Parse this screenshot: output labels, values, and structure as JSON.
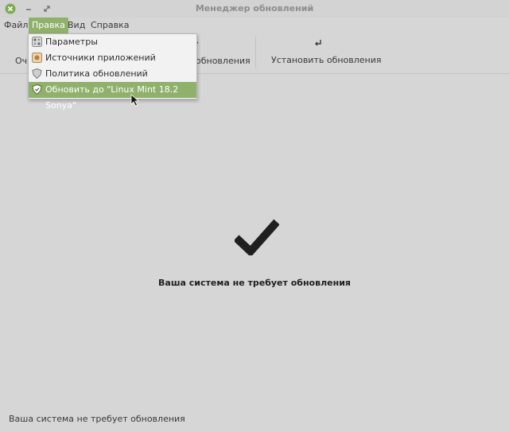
{
  "window": {
    "title": "Менеджер обновлений"
  },
  "menubar": {
    "items": [
      "Файл",
      "Правка",
      "Вид",
      "Справка"
    ],
    "active": "Правка"
  },
  "toolbar": {
    "clear_label_partial": "Очи",
    "refresh_label_partial": "обновления",
    "install_label": "Установить обновления"
  },
  "edit_menu": {
    "items": [
      {
        "label": "Параметры",
        "icon": "preferences-icon"
      },
      {
        "label": "Источники приложений",
        "icon": "software-sources-icon"
      },
      {
        "label": "Политика обновлений",
        "icon": "shield-icon"
      },
      {
        "label": "Обновить до \"Linux Mint 18.2 Sonya\"",
        "icon": "mint-shield-icon",
        "highlighted": true
      }
    ]
  },
  "main": {
    "status_message": "Ваша система не требует обновления",
    "icon": "checkmark-icon"
  },
  "statusbar": {
    "text": "Ваша система не требует обновления"
  },
  "colors": {
    "accent": "#8fb16b",
    "close": "#7cac4f",
    "background": "#d6d6d6"
  }
}
